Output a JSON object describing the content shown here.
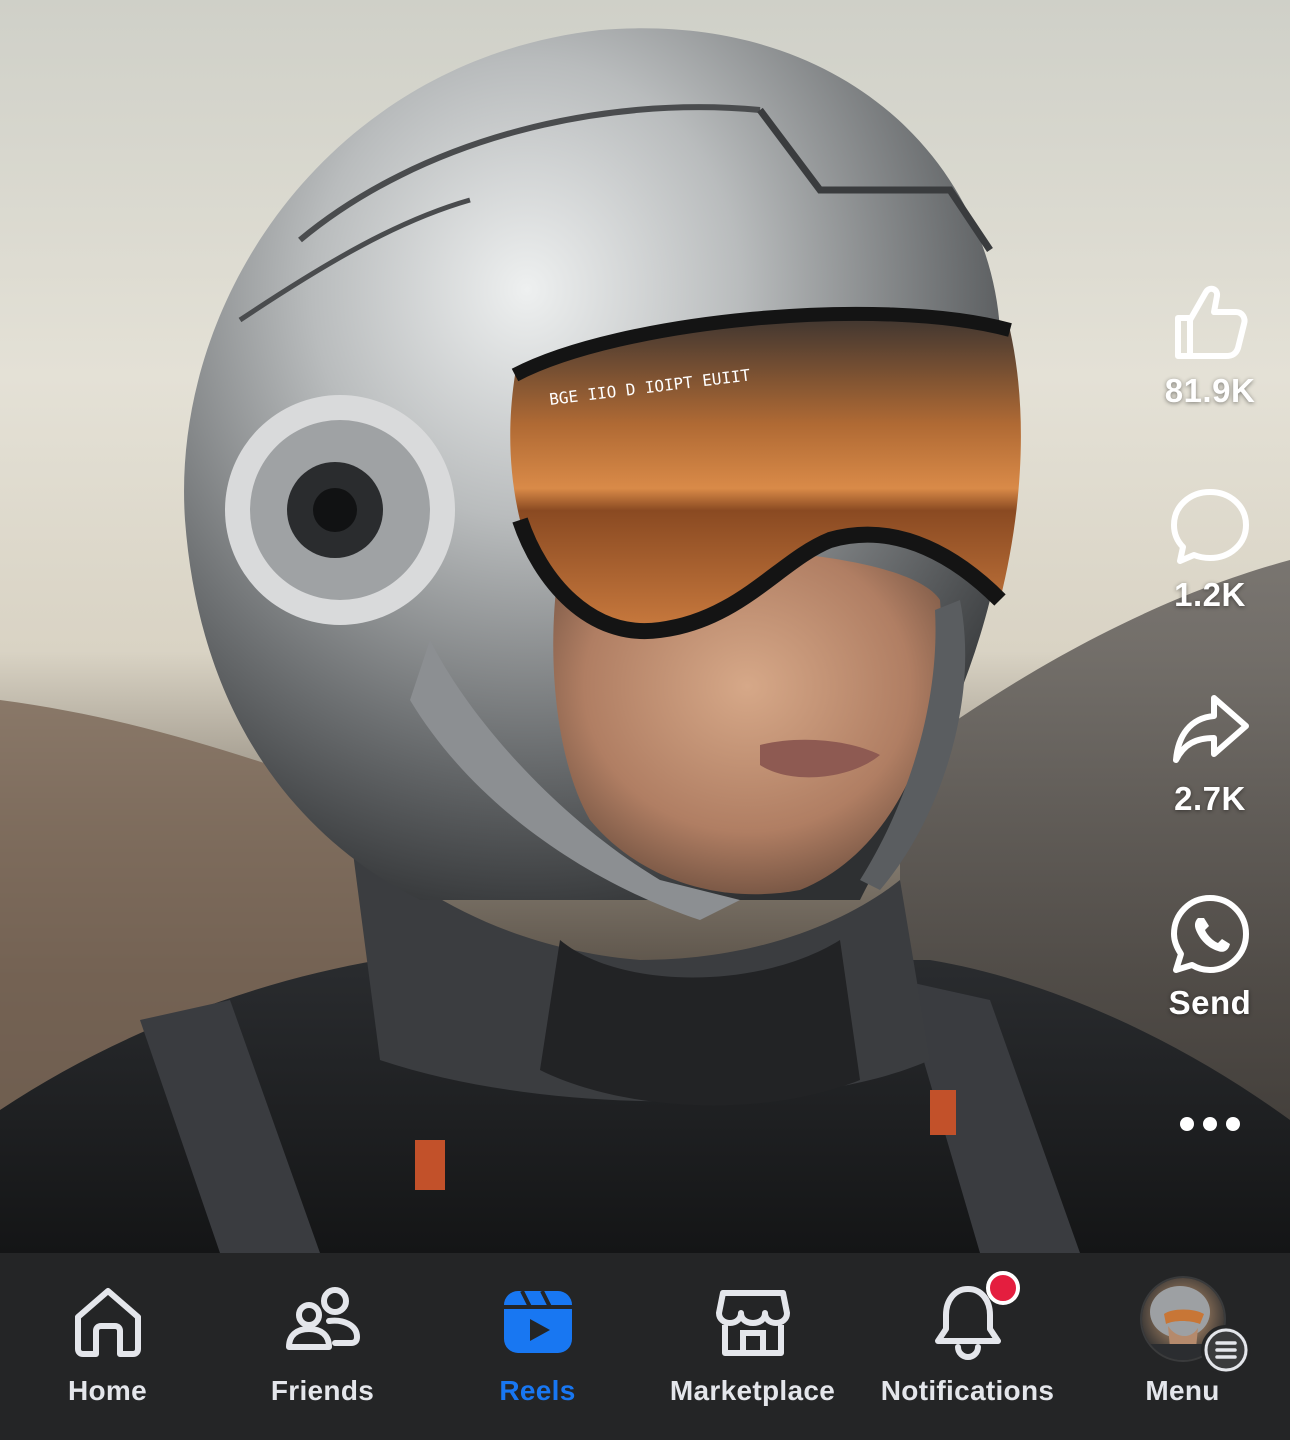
{
  "reel": {
    "likes": "81.9K",
    "comments": "1.2K",
    "shares": "2.7K",
    "send_label": "Send",
    "visor_text": "BGE IIO D IOIPT   EUIIT"
  },
  "nav": {
    "items": [
      {
        "label": "Home",
        "icon": "home-icon",
        "active": false
      },
      {
        "label": "Friends",
        "icon": "friends-icon",
        "active": false
      },
      {
        "label": "Reels",
        "icon": "reels-icon",
        "active": true
      },
      {
        "label": "Marketplace",
        "icon": "marketplace-icon",
        "active": false
      },
      {
        "label": "Notifications",
        "icon": "bell-icon",
        "active": false,
        "has_badge": true
      },
      {
        "label": "Menu",
        "icon": "avatar",
        "active": false
      }
    ]
  },
  "colors": {
    "nav_background": "#242526",
    "active_accent": "#1877f2",
    "inactive_text": "#e4e6eb",
    "badge_red": "#e41e3f"
  }
}
